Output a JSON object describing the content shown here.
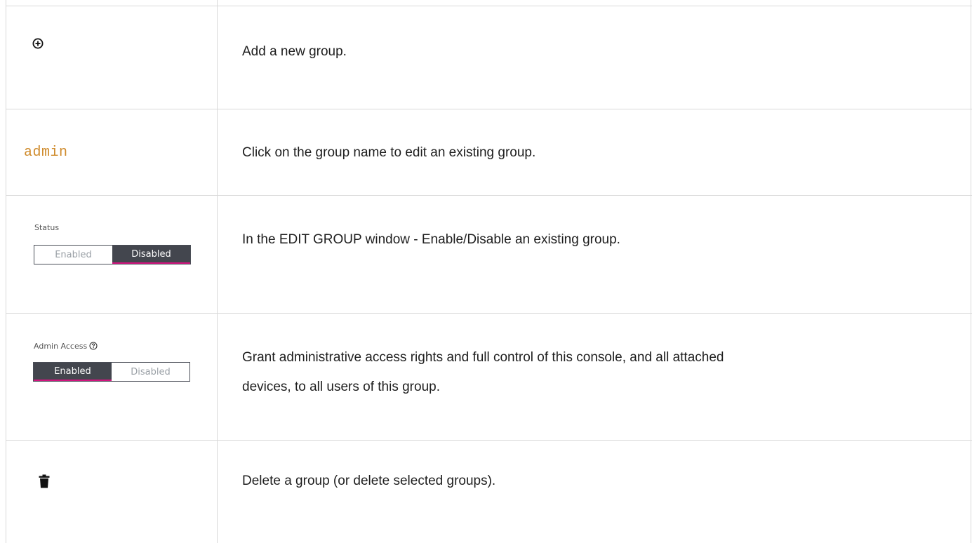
{
  "rows": [
    {
      "icon": "add-circle-icon",
      "description": "Add a new group."
    },
    {
      "link_text": "admin",
      "link_color": "#cf8b2c",
      "description": "Click on the group name to edit an existing group."
    },
    {
      "toggle_label": "Status",
      "options": [
        "Enabled",
        "Disabled"
      ],
      "selected": "Disabled",
      "description": "In the EDIT GROUP window - Enable/Disable an existing group."
    },
    {
      "toggle_label": "Admin Access",
      "help_icon": "help-circle-icon",
      "options": [
        "Enabled",
        "Disabled"
      ],
      "selected": "Enabled",
      "description_line1": "Grant administrative access rights and full control of this console, and all attached",
      "description_line2": "devices, to all users of this group."
    },
    {
      "icon": "trash-icon",
      "description": "Delete a group (or delete selected groups)."
    }
  ],
  "colors": {
    "selected_bg": "#43464e",
    "selected_underline": "#d4147f",
    "grid_line": "#d9d9d9"
  }
}
